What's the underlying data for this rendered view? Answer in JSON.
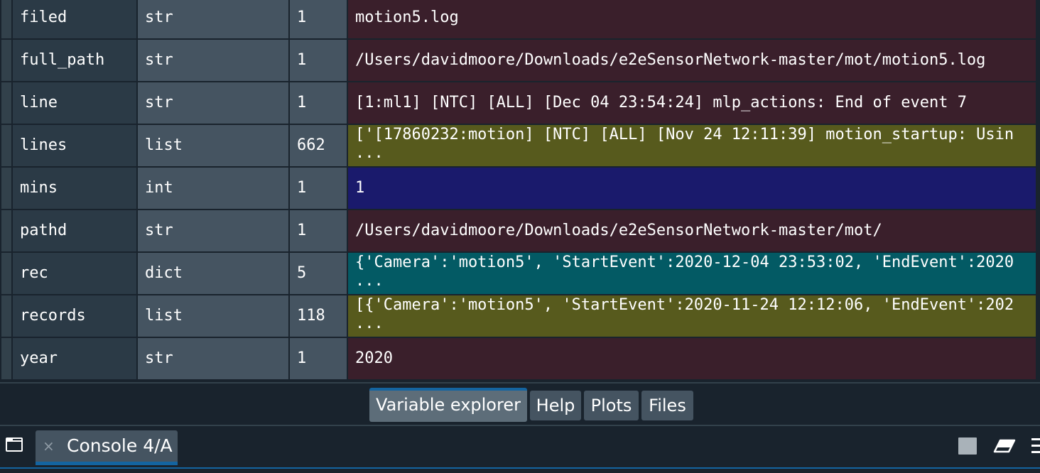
{
  "colors": {
    "str": "#3a1f2b",
    "list": "#575a1d",
    "int": "#1a1a6c",
    "dict": "#035a64",
    "accent": "#1464a0"
  },
  "variables": [
    {
      "name": "filed",
      "type": "str",
      "size": "1",
      "value": [
        "motion5.log"
      ]
    },
    {
      "name": "full_path",
      "type": "str",
      "size": "1",
      "value": [
        "/Users/davidmoore/Downloads/e2eSensorNetwork-master/mot/motion5.log"
      ]
    },
    {
      "name": "line",
      "type": "str",
      "size": "1",
      "value": [
        "[1:ml1] [NTC] [ALL] [Dec 04 23:54:24] mlp_actions: End of event 7"
      ]
    },
    {
      "name": "lines",
      "type": "list",
      "size": "662",
      "value": [
        "['[17860232:motion] [NTC] [ALL] [Nov 24 12:11:39] motion_startup: Usin",
        "..."
      ]
    },
    {
      "name": "mins",
      "type": "int",
      "size": "1",
      "value": [
        "1"
      ]
    },
    {
      "name": "pathd",
      "type": "str",
      "size": "1",
      "value": [
        "/Users/davidmoore/Downloads/e2eSensorNetwork-master/mot/"
      ]
    },
    {
      "name": "rec",
      "type": "dict",
      "size": "5",
      "value": [
        "{'Camera':'motion5', 'StartEvent':2020-12-04 23:53:02, 'EndEvent':2020",
        "..."
      ]
    },
    {
      "name": "records",
      "type": "list",
      "size": "118",
      "value": [
        "[{'Camera':'motion5', 'StartEvent':2020-11-24 12:12:06, 'EndEvent':202",
        "..."
      ]
    },
    {
      "name": "year",
      "type": "str",
      "size": "1",
      "value": [
        "2020"
      ]
    }
  ],
  "pane_tabs": [
    {
      "label": "Variable explorer",
      "active": true
    },
    {
      "label": "Help",
      "active": false
    },
    {
      "label": "Plots",
      "active": false
    },
    {
      "label": "Files",
      "active": false
    }
  ],
  "console": {
    "close_glyph": "×",
    "tab_label": "Console 4/A"
  },
  "icons": {
    "browse_tabs": "browse-tabs-icon",
    "stop": "stop-icon",
    "clear": "eraser-icon",
    "options": "menu-icon"
  }
}
